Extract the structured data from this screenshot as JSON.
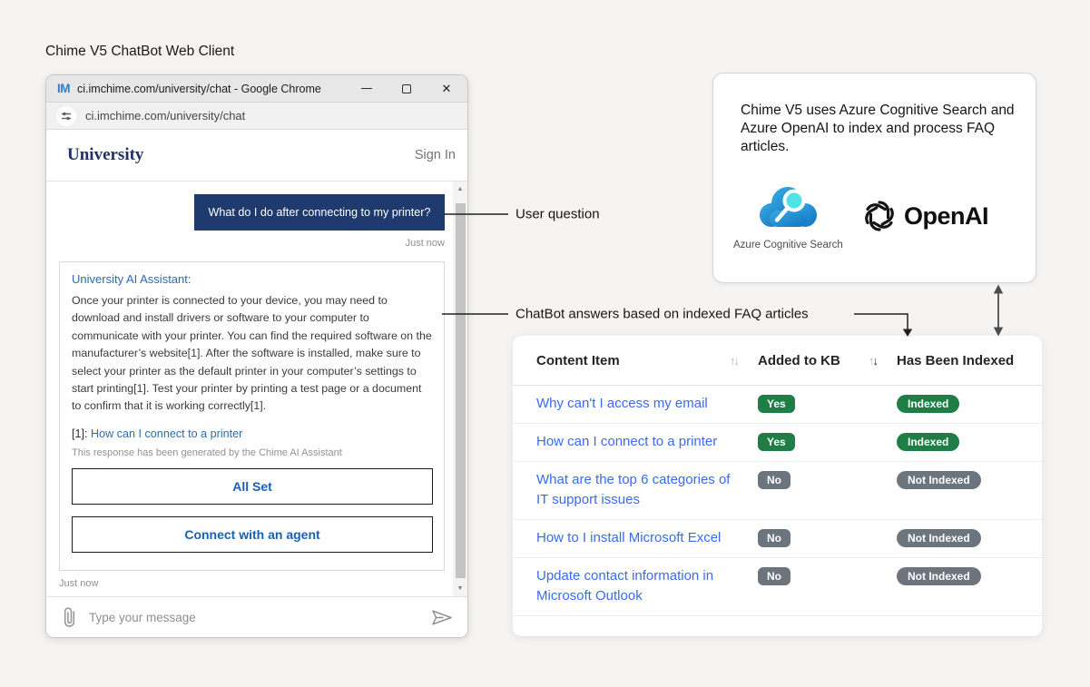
{
  "page": {
    "title": "Chime V5 ChatBot Web Client"
  },
  "browser": {
    "logo_text": "IM",
    "window_title": "ci.imchime.com/university/chat - Google Chrome",
    "url": "ci.imchime.com/university/chat"
  },
  "chat": {
    "brand": "University",
    "sign_in": "Sign In",
    "user_message": {
      "text": "What do I do after connecting to my printer?",
      "timestamp": "Just now"
    },
    "bot_message": {
      "sender": "University AI Assistant:",
      "body": "Once your printer is connected to your device, you may need to download and install drivers or software to your computer to communicate with your printer. You can find the required software on the manufacturer’s website[1]. After the software is installed, make sure to select your printer as the default printer in your computer’s settings to start printing[1]. Test your printer by printing a test page or a document to confirm that it is working correctly[1].",
      "citation_label": "[1]:",
      "citation_link": "How can I connect to a printer",
      "disclaimer": "This response has been generated by the Chime AI Assistant",
      "buttons": [
        "All Set",
        "Connect with an agent"
      ],
      "timestamp": "Just now"
    },
    "composer": {
      "placeholder": "Type your message"
    }
  },
  "annotations": {
    "user_question": "User question",
    "chatbot_answers": "ChatBot answers based on indexed FAQ articles"
  },
  "info_card": {
    "text": "Chime V5 uses Azure Cognitive Search and Azure OpenAI to index and process FAQ articles.",
    "azure_label": "Azure Cognitive Search",
    "openai_label": "OpenAI"
  },
  "table": {
    "columns": [
      "Content Item",
      "Added to KB",
      "Has Been Indexed"
    ],
    "rows": [
      {
        "item": "Why can't I access my email",
        "added": "Yes",
        "indexed": "Indexed",
        "status": "yes"
      },
      {
        "item": "How can I connect to a printer",
        "added": "Yes",
        "indexed": "Indexed",
        "status": "yes"
      },
      {
        "item": "What are the top 6 categories of IT support issues",
        "added": "No",
        "indexed": "Not Indexed",
        "status": "no"
      },
      {
        "item": "How to I install Microsoft Excel",
        "added": "No",
        "indexed": "Not Indexed",
        "status": "no"
      },
      {
        "item": "Update contact information in Microsoft Outlook",
        "added": "No",
        "indexed": "Not Indexed",
        "status": "no"
      }
    ]
  },
  "icons": {
    "close": "✕",
    "scroll_up": "▲",
    "scroll_down": "▼",
    "sort_up": "↑",
    "sort_down": "↓"
  },
  "colors": {
    "accent_navy": "#1f3a6d",
    "link_blue": "#2b6cb0",
    "table_link_blue": "#3a6af0",
    "badge_green": "#1e7e46",
    "badge_gray": "#6c757d",
    "azure_blue": "#1279c4",
    "azure_cyan": "#4fe3e8"
  }
}
